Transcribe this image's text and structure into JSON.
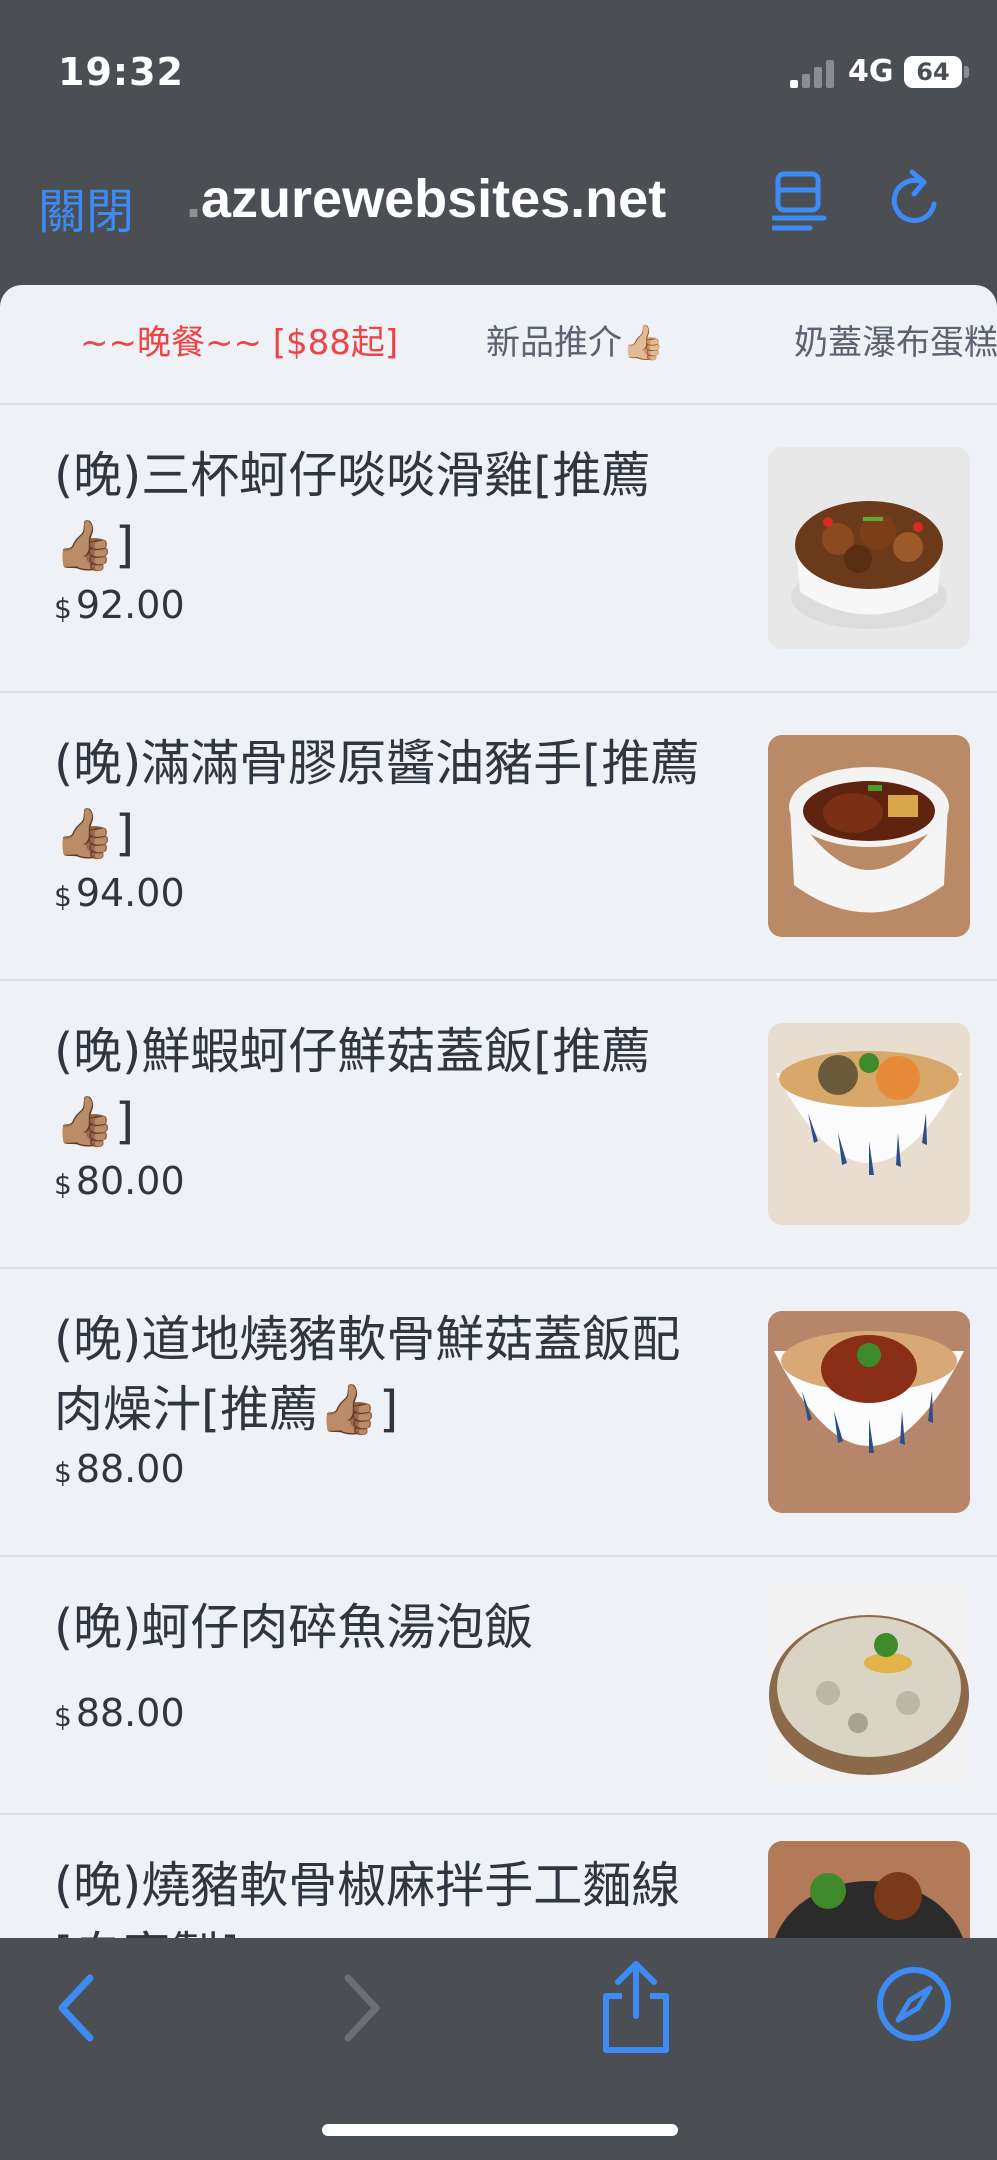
{
  "status": {
    "time": "19:32",
    "network": "4G",
    "battery": "64"
  },
  "browser": {
    "close_label": "關閉",
    "url_dot": ".",
    "url": "azurewebsites.net"
  },
  "tabs": [
    {
      "label": "~~晚餐~~ [$88起]",
      "active": true
    },
    {
      "label": "新品推介👍🏼",
      "active": false
    },
    {
      "label": "奶蓋瀑布蛋糕",
      "active": false
    }
  ],
  "items": [
    {
      "name": "(晚)三杯蚵仔啖啖滑雞[推薦👍🏽]",
      "currency": "$",
      "price": "92.00"
    },
    {
      "name": "(晚)滿滿骨膠原醬油豬手[推薦👍🏽]",
      "currency": "$",
      "price": "94.00"
    },
    {
      "name": "(晚)鮮蝦蚵仔鮮菇蓋飯[推薦👍🏽]",
      "currency": "$",
      "price": "80.00"
    },
    {
      "name": "(晚)道地燒豬軟骨鮮菇蓋飯配肉燥汁[推薦👍🏽]",
      "currency": "$",
      "price": "88.00"
    },
    {
      "name": "(晚)蚵仔肉碎魚湯泡飯",
      "currency": "$",
      "price": "88.00"
    },
    {
      "name": "(晚)燒豬軟骨椒麻拌手工麵線[自家製]",
      "currency": "$",
      "price": ""
    }
  ],
  "icons": {
    "back": "chevron-left-icon",
    "forward": "chevron-right-icon",
    "share": "share-icon",
    "safari": "compass-icon",
    "reader": "reader-list-icon",
    "reload": "reload-icon"
  },
  "colors": {
    "accent": "#3d8bf5",
    "active_tab": "#ef4444",
    "chrome": "#4b4f53",
    "content_bg": "#eef1f5"
  }
}
